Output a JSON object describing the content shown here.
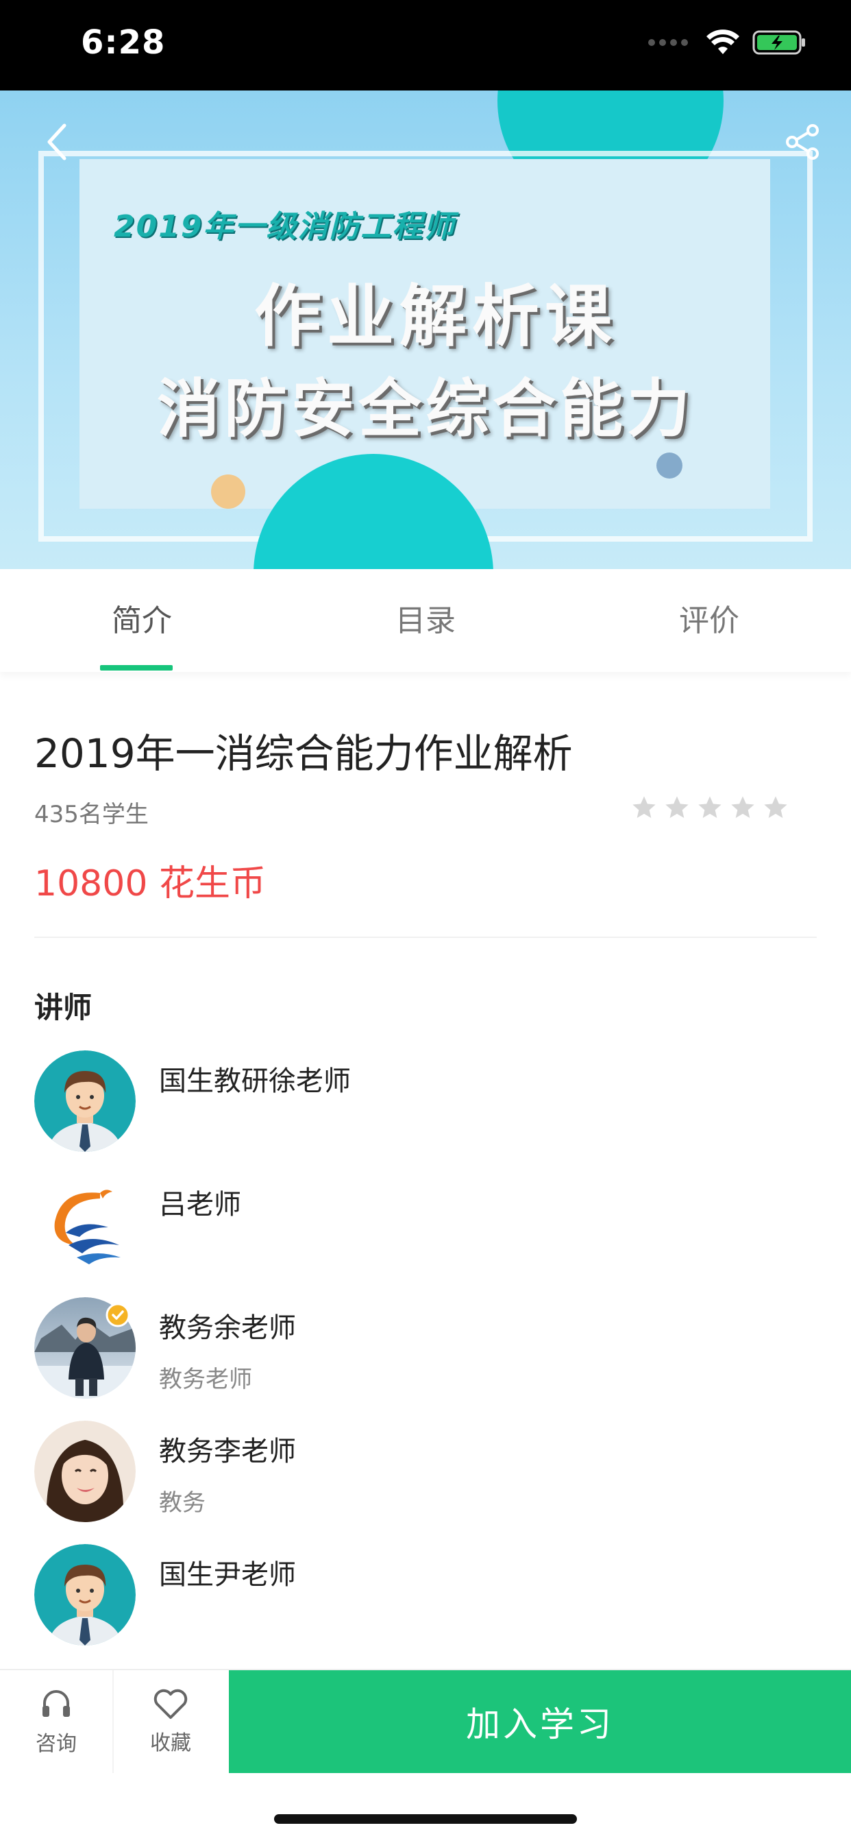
{
  "status_bar": {
    "time": "6:28"
  },
  "banner": {
    "subtitle": "2019年一级消防工程师",
    "title_line1": "作业解析课",
    "title_line2": "消防安全综合能力"
  },
  "tabs": [
    {
      "label": "简介",
      "active": true
    },
    {
      "label": "目录",
      "active": false
    },
    {
      "label": "评价",
      "active": false
    }
  ],
  "course": {
    "title": "2019年一消综合能力作业解析",
    "students": "435名学生",
    "rating": 0,
    "rating_max": 5,
    "price": "10800 花生币"
  },
  "lecturers_section": {
    "title": "讲师",
    "items": [
      {
        "name": "国生教研徐老师",
        "role": "",
        "avatar": "cartoon-man-avatar"
      },
      {
        "name": "吕老师",
        "role": "",
        "avatar": "logo-avatar"
      },
      {
        "name": "教务余老师",
        "role": "教务老师",
        "avatar": "photo-man-avatar"
      },
      {
        "name": "教务李老师",
        "role": "教务",
        "avatar": "photo-woman-avatar"
      },
      {
        "name": "国生尹老师",
        "role": "",
        "avatar": "cartoon-man-avatar"
      }
    ]
  },
  "bottom_bar": {
    "consult_label": "咨询",
    "favorite_label": "收藏",
    "join_label": "加入学习"
  },
  "colors": {
    "accent": "#1cc47a",
    "price": "#f04848",
    "teal": "#16c8c9"
  }
}
